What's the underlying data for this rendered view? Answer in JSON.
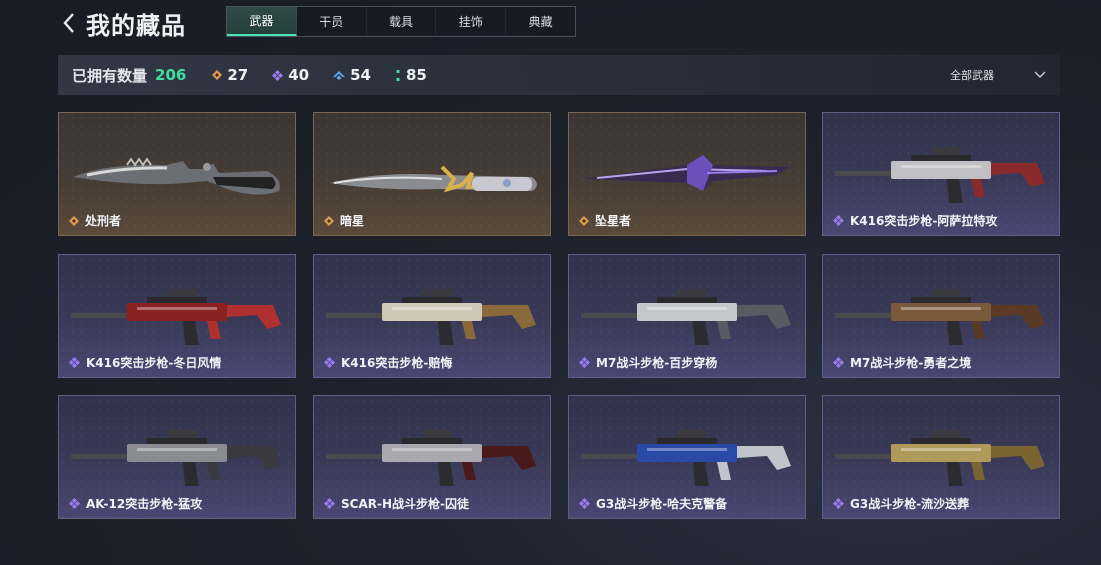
{
  "header": {
    "title": "我的藏品"
  },
  "tabs": [
    {
      "label": "武器",
      "active": true
    },
    {
      "label": "干员",
      "active": false
    },
    {
      "label": "载具",
      "active": false
    },
    {
      "label": "挂饰",
      "active": false
    },
    {
      "label": "典藏",
      "active": false
    }
  ],
  "stats": {
    "owned_label": "已拥有数量",
    "owned_count": "206",
    "orange_count": "27",
    "purple_count": "40",
    "blue_count": "54",
    "green_count": "85"
  },
  "filter": {
    "label": "全部武器"
  },
  "colors": {
    "accent": "#3fe09f",
    "orange": "#e39a4a",
    "purple": "#9a7cf0",
    "blue": "#5fa8e8",
    "green": "#3fe09f"
  },
  "items": [
    {
      "name": "处刑者",
      "rarity": "orange",
      "kind": "knife"
    },
    {
      "name": "暗星",
      "rarity": "orange",
      "kind": "knife"
    },
    {
      "name": "坠星者",
      "rarity": "orange",
      "kind": "knife"
    },
    {
      "name": "K416突击步枪-阿萨拉特攻",
      "rarity": "purple",
      "kind": "rifle"
    },
    {
      "name": "K416突击步枪-冬日风情",
      "rarity": "purple",
      "kind": "rifle"
    },
    {
      "name": "K416突击步枪-赔悔",
      "rarity": "purple",
      "kind": "rifle"
    },
    {
      "name": "M7战斗步枪-百步穿杨",
      "rarity": "purple",
      "kind": "rifle"
    },
    {
      "name": "M7战斗步枪-勇者之境",
      "rarity": "purple",
      "kind": "rifle"
    },
    {
      "name": "AK-12突击步枪-猛攻",
      "rarity": "purple",
      "kind": "rifle"
    },
    {
      "name": "SCAR-H战斗步枪-囚徒",
      "rarity": "purple",
      "kind": "rifle"
    },
    {
      "name": "G3战斗步枪-哈夫克警备",
      "rarity": "purple",
      "kind": "rifle"
    },
    {
      "name": "G3战斗步枪-流沙送葬",
      "rarity": "purple",
      "kind": "rifle"
    }
  ]
}
